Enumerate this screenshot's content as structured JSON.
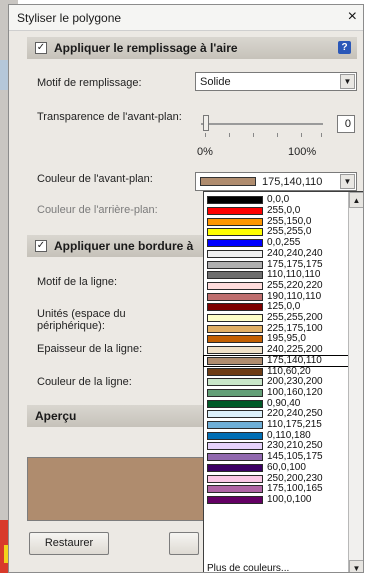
{
  "dialog": {
    "title": "Styliser le polygone",
    "close_glyph": "×"
  },
  "fill": {
    "section_label": "Appliquer le remplissage à l'aire",
    "checked": true,
    "help_glyph": "?",
    "pattern_label": "Motif de remplissage:",
    "pattern_value": "Solide",
    "transparency_label": "Transparence de l'avant-plan:",
    "transparency_value": "0",
    "slider_min_label": "0%",
    "slider_max_label": "100%",
    "fg_color_label": "Couleur de l'avant-plan:",
    "fg_color_value": "175,140,110",
    "fg_color_hex": "#af8c6e",
    "bg_color_label": "Couleur de l'arrière-plan:"
  },
  "border": {
    "section_label": "Appliquer une bordure à",
    "checked": true,
    "line_pattern_label": "Motif de la ligne:",
    "units_label": "Unités (espace du périphérique):",
    "thickness_label": "Epaisseur de la ligne:",
    "line_color_label": "Couleur de la ligne:"
  },
  "preview": {
    "section_label": "Aperçu",
    "fill_hex": "#af8c6e"
  },
  "buttons": {
    "restore_label": "Restaurer"
  },
  "color_dropdown": {
    "selected_index": 15,
    "items": [
      {
        "label": "0,0,0",
        "hex": "#000000"
      },
      {
        "label": "255,0,0",
        "hex": "#ff0000"
      },
      {
        "label": "255,150,0",
        "hex": "#ff9600"
      },
      {
        "label": "255,255,0",
        "hex": "#ffff00"
      },
      {
        "label": "0,0,255",
        "hex": "#0000ff"
      },
      {
        "label": "240,240,240",
        "hex": "#f0f0f0"
      },
      {
        "label": "175,175,175",
        "hex": "#afafaf"
      },
      {
        "label": "110,110,110",
        "hex": "#6e6e6e"
      },
      {
        "label": "255,220,220",
        "hex": "#ffdcdc"
      },
      {
        "label": "190,110,110",
        "hex": "#be6e6e"
      },
      {
        "label": "125,0,0",
        "hex": "#7d0000"
      },
      {
        "label": "255,255,200",
        "hex": "#ffffc8"
      },
      {
        "label": "225,175,100",
        "hex": "#e1af64"
      },
      {
        "label": "195,95,0",
        "hex": "#c35f00"
      },
      {
        "label": "240,225,200",
        "hex": "#f0e1c8"
      },
      {
        "label": "175,140,110",
        "hex": "#af8c6e"
      },
      {
        "label": "110,60,20",
        "hex": "#6e3c14"
      },
      {
        "label": "200,230,200",
        "hex": "#c8e6c8"
      },
      {
        "label": "100,160,120",
        "hex": "#64a078"
      },
      {
        "label": "0,90,40",
        "hex": "#005a28"
      },
      {
        "label": "220,240,250",
        "hex": "#dcf0fa"
      },
      {
        "label": "110,175,215",
        "hex": "#6eafd7"
      },
      {
        "label": "0,110,180",
        "hex": "#006eb4"
      },
      {
        "label": "230,210,250",
        "hex": "#e6d2fa"
      },
      {
        "label": "145,105,175",
        "hex": "#9169af"
      },
      {
        "label": "60,0,100",
        "hex": "#3c0064"
      },
      {
        "label": "250,200,230",
        "hex": "#fac8e6"
      },
      {
        "label": "175,100,165",
        "hex": "#af64a5"
      },
      {
        "label": "100,0,100",
        "hex": "#640064"
      }
    ],
    "more_label": "Plus de couleurs..."
  }
}
